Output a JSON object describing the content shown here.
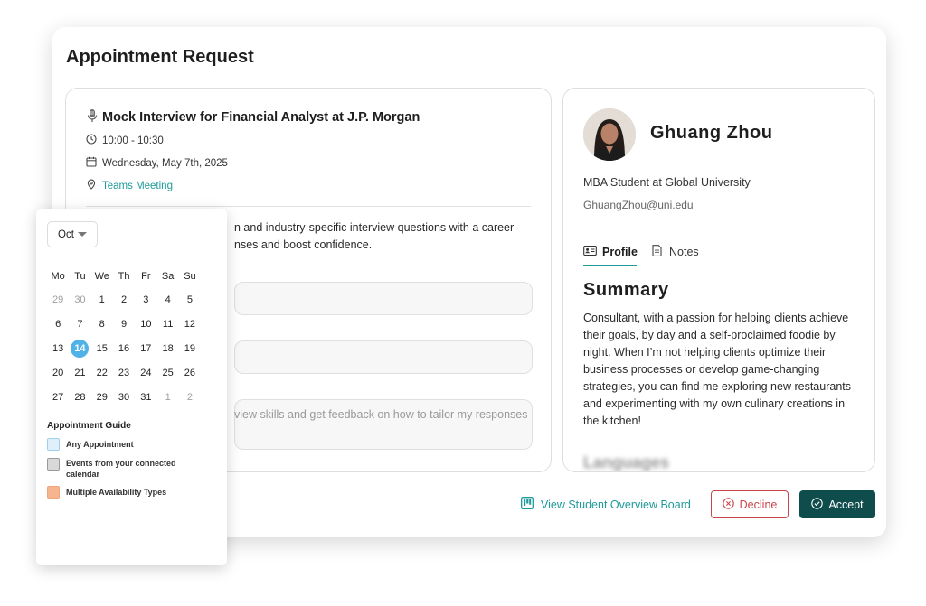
{
  "modal": {
    "title": "Appointment Request"
  },
  "event": {
    "icon": "microphone-icon",
    "title": "Mock Interview for Financial Analyst at J.P. Morgan",
    "time": "10:00 - 10:30",
    "date": "Wednesday, May 7th, 2025",
    "location": "Teams Meeting",
    "description": "n and industry-specific interview questions with a career nses and boost confidence.",
    "description_line1": "n and industry-specific interview questions with a career",
    "description_line2": "nses and boost confidence.",
    "field3_text": "view skills and get feedback on how to tailor my responses"
  },
  "student": {
    "name": "Ghuang Zhou",
    "role": "MBA Student at Global University",
    "email": "GhuangZhou@uni.edu",
    "tabs": [
      {
        "label": "Profile",
        "icon": "id-card-icon",
        "active": true
      },
      {
        "label": "Notes",
        "icon": "document-icon",
        "active": false
      }
    ],
    "summary_heading": "Summary",
    "summary_lines": [
      "Consultant, with a passion for helping clients achieve",
      "their goals, by day and a self-proclaimed foodie by",
      "night. When I’m not helping clients optimize their",
      "business processes or develop game-changing",
      "strategies, you can find me exploring new restaurants",
      "and experimenting with my own culinary creations in",
      "the kitchen!"
    ],
    "next_heading": "Languages"
  },
  "actions": {
    "overview_label": "View Student Overview Board",
    "decline_label": "Decline",
    "accept_label": "Accept"
  },
  "calendar": {
    "month": "Oct",
    "weekdays": [
      "Mo",
      "Tu",
      "We",
      "Th",
      "Fr",
      "Sa",
      "Su"
    ],
    "weeks": [
      [
        "29",
        "30",
        "1",
        "2",
        "3",
        "4",
        "5"
      ],
      [
        "6",
        "7",
        "8",
        "9",
        "10",
        "11",
        "12"
      ],
      [
        "13",
        "14",
        "15",
        "16",
        "17",
        "18",
        "19"
      ],
      [
        "20",
        "21",
        "22",
        "23",
        "24",
        "25",
        "26"
      ],
      [
        "27",
        "28",
        "29",
        "30",
        "31",
        "1",
        "2"
      ]
    ],
    "selected_day": "14",
    "guide_title": "Appointment Guide",
    "guide_items": [
      {
        "label": "Any Appointment",
        "color": "#dff0fb",
        "border": "#9fd0ef"
      },
      {
        "label": "Events from your connected calendar",
        "color": "#d9d9d9",
        "border": "#9a9a9a"
      },
      {
        "label": "Multiple Availability Types",
        "color": "#f6b58f",
        "border": "#eea57c"
      }
    ]
  },
  "colors": {
    "accent": "#1e9a9a",
    "accept_bg": "#0f4c4c",
    "decline": "#c9454a",
    "selected_day": "#4fb3e8"
  }
}
